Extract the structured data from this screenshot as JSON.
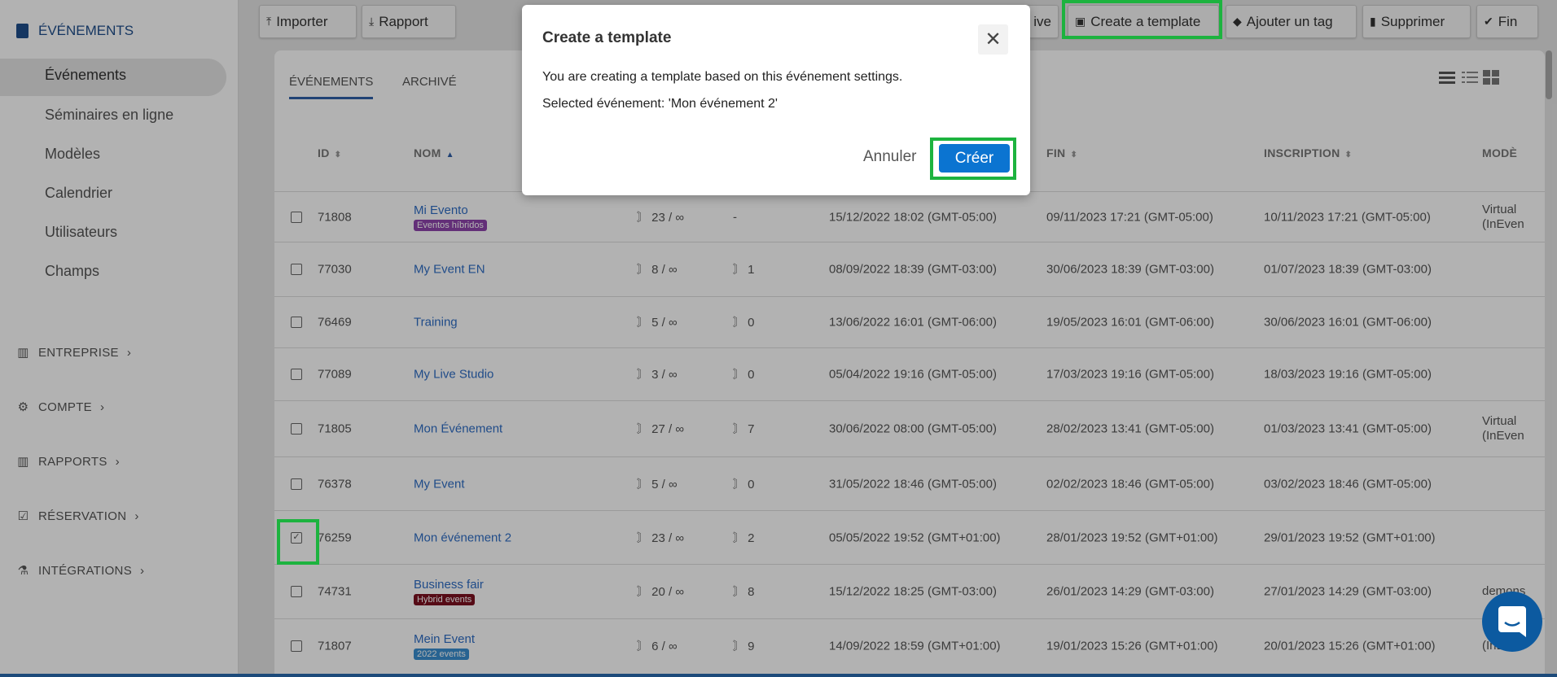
{
  "sidebar": {
    "header": "ÉVÉNEMENTS",
    "items": [
      "Événements",
      "Séminaires en ligne",
      "Modèles",
      "Calendrier",
      "Utilisateurs",
      "Champs"
    ],
    "sections": [
      {
        "label": "ENTREPRISE",
        "icon": "building-icon"
      },
      {
        "label": "COMPTE",
        "icon": "gear-icon"
      },
      {
        "label": "RAPPORTS",
        "icon": "building-icon"
      },
      {
        "label": "RÉSERVATION",
        "icon": "calendar-check-icon"
      },
      {
        "label": "INTÉGRATIONS",
        "icon": "flask-icon"
      }
    ]
  },
  "toolbar": {
    "importer": "Importer",
    "rapport": "Rapport",
    "archive_partial": "ive",
    "create_template": "Create a template",
    "add_tag": "Ajouter un tag",
    "delete": "Supprimer",
    "end": "Fin"
  },
  "tabs": [
    "ÉVÉNEMENTS",
    "ARCHIVÉ"
  ],
  "columns": {
    "id": "ID",
    "name": "NOM",
    "end": "FIN",
    "registration": "INSCRIPTION",
    "model": "MODÈ"
  },
  "rows": [
    {
      "id": "71808",
      "name": "Mi Evento",
      "badge": "Eventos híbridos",
      "badge_color": "#8e44ad",
      "cap": "23 / ∞",
      "c2": "-",
      "c2rss": false,
      "start": "15/12/2022 18:02 (GMT-05:00)",
      "end": "09/11/2023 17:21 (GMT-05:00)",
      "reg": "10/11/2023 17:21 (GMT-05:00)",
      "model": [
        "Virtual",
        "(InEven"
      ]
    },
    {
      "id": "77030",
      "name": "My Event EN",
      "cap": "8 / ∞",
      "c2": "1",
      "c2rss": true,
      "start": "08/09/2022 18:39 (GMT-03:00)",
      "end": "30/06/2023 18:39 (GMT-03:00)",
      "reg": "01/07/2023 18:39 (GMT-03:00)"
    },
    {
      "id": "76469",
      "name": "Training",
      "cap": "5 / ∞",
      "c2": "0",
      "c2rss": true,
      "start": "13/06/2022 16:01 (GMT-06:00)",
      "end": "19/05/2023 16:01 (GMT-06:00)",
      "reg": "30/06/2023 16:01 (GMT-06:00)"
    },
    {
      "id": "77089",
      "name": "My Live Studio",
      "cap": "3 / ∞",
      "c2": "0",
      "c2rss": true,
      "start": "05/04/2022 19:16 (GMT-05:00)",
      "end": "17/03/2023 19:16 (GMT-05:00)",
      "reg": "18/03/2023 19:16 (GMT-05:00)"
    },
    {
      "id": "71805",
      "name": "Mon Événement",
      "cap": "27 / ∞",
      "c2": "7",
      "c2rss": true,
      "start": "30/06/2022 08:00 (GMT-05:00)",
      "end": "28/02/2023 13:41 (GMT-05:00)",
      "reg": "01/03/2023 13:41 (GMT-05:00)",
      "model": [
        "Virtual",
        "(InEven"
      ]
    },
    {
      "id": "76378",
      "name": "My Event",
      "cap": "5 / ∞",
      "c2": "0",
      "c2rss": true,
      "start": "31/05/2022 18:46 (GMT-05:00)",
      "end": "02/02/2023 18:46 (GMT-05:00)",
      "reg": "03/02/2023 18:46 (GMT-05:00)"
    },
    {
      "id": "76259",
      "name": "Mon événement 2",
      "checked": true,
      "cap": "23 / ∞",
      "c2": "2",
      "c2rss": true,
      "start": "05/05/2022 19:52 (GMT+01:00)",
      "end": "28/01/2023 19:52 (GMT+01:00)",
      "reg": "29/01/2023 19:52 (GMT+01:00)"
    },
    {
      "id": "74731",
      "name": "Business fair",
      "badge": "Hybrid events",
      "badge_color": "#7b1020",
      "cap": "20 / ∞",
      "c2": "8",
      "c2rss": true,
      "start": "15/12/2022 18:25 (GMT-03:00)",
      "end": "26/01/2023 14:29 (GMT-03:00)",
      "reg": "27/01/2023 14:29 (GMT-03:00)",
      "model": [
        "demons"
      ]
    },
    {
      "id": "71807",
      "name": "Mein Event",
      "badge": "2022 events",
      "badge_color": "#3a8fd0",
      "cap": "6 / ∞",
      "c2": "9",
      "c2rss": true,
      "start": "14/09/2022 18:59 (GMT+01:00)",
      "end": "19/01/2023 15:26 (GMT+01:00)",
      "reg": "20/01/2023 15:26 (GMT+01:00)",
      "model": [
        "",
        "(InEven"
      ]
    }
  ],
  "dialog": {
    "title": "Create a template",
    "line1": "You are creating a template based on this événement settings.",
    "line2": "Selected événement: 'Mon événement 2'",
    "cancel": "Annuler",
    "create": "Créer"
  },
  "colors": {
    "accent": "#0b74d1",
    "highlight": "#1db33f",
    "link": "#2f6dc4"
  }
}
